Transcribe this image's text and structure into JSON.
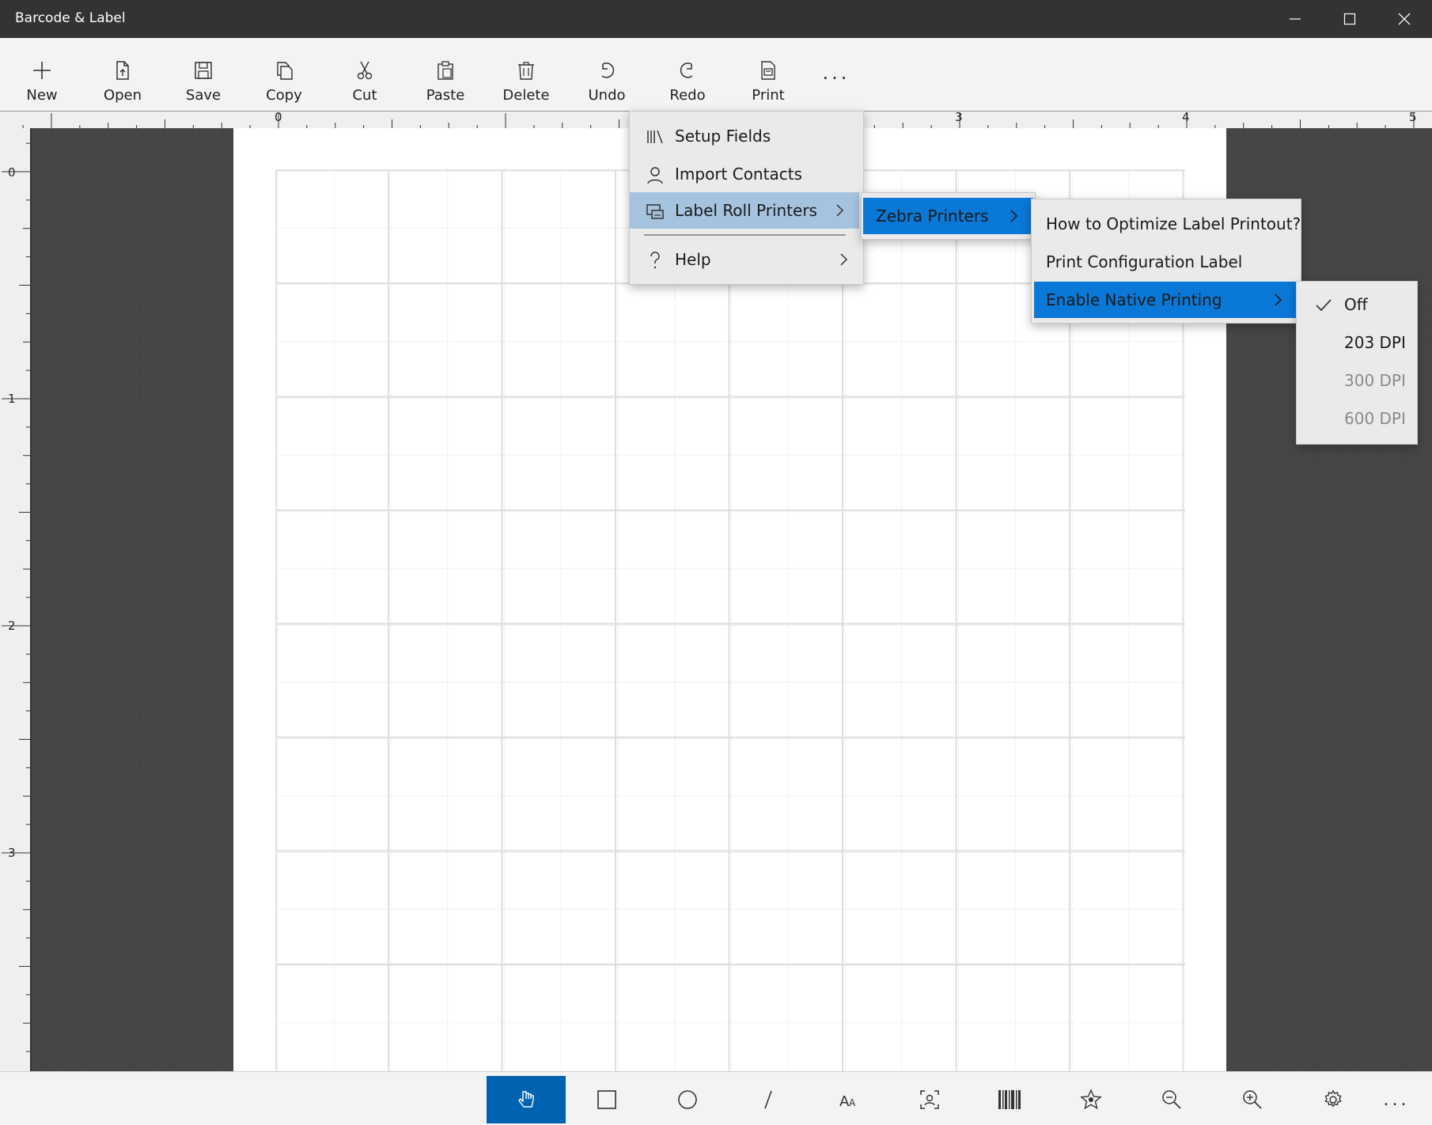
{
  "window": {
    "title": "Barcode & Label"
  },
  "toolbar": {
    "new": "New",
    "open": "Open",
    "save": "Save",
    "copy": "Copy",
    "cut": "Cut",
    "paste": "Paste",
    "delete": "Delete",
    "undo": "Undo",
    "redo": "Redo",
    "print": "Print",
    "more": "..."
  },
  "ruler": {
    "horizontal": [
      "0",
      "3",
      "4",
      "5"
    ],
    "vertical": [
      "0",
      "1",
      "2",
      "3"
    ]
  },
  "menu_main": {
    "items": [
      "Setup Fields",
      "Import Contacts",
      "Label Roll Printers",
      "Help"
    ]
  },
  "menu_printers": {
    "items": [
      "Zebra Printers"
    ]
  },
  "menu_zebra": {
    "items": [
      "How to Optimize Label Printout?",
      "Print Configuration Label",
      "Enable Native Printing"
    ]
  },
  "menu_native": {
    "items": [
      "Off",
      "203 DPI",
      "300 DPI",
      "600 DPI"
    ],
    "checked": "Off"
  },
  "colors": {
    "accent": "#0063b1",
    "highlight": "#a5c3df",
    "selected": "#0a78d7"
  }
}
